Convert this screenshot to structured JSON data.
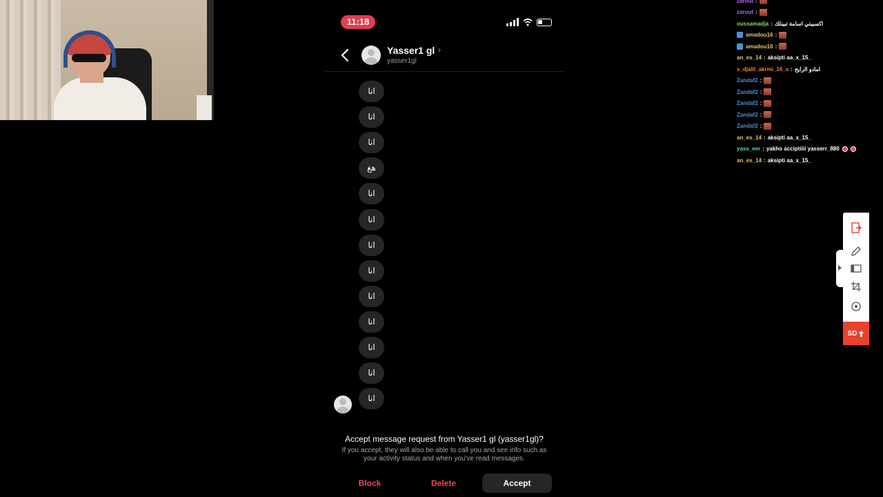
{
  "phone": {
    "status": {
      "time": "11:18"
    },
    "header": {
      "name": "Yasser1 gl",
      "chevron": "›",
      "username": "yasser1gl"
    },
    "messages": [
      "انا",
      "انا",
      "انا",
      "هغ",
      "انا",
      "انا",
      "انا",
      "انا",
      "انا",
      "انا",
      "انا",
      "انا",
      "انا"
    ],
    "request": {
      "title": "Accept message request from Yasser1 gl (yasser1gl)?",
      "body": "If you accept, they will also be able to call you and see info such as your activity status and when you've read messages."
    },
    "actions": {
      "block": "Block",
      "delete": "Delete",
      "accept": "Accept"
    },
    "colors": {
      "time_pill": "#e23d50",
      "destructive": "#ed4956",
      "bubble": "#262626"
    }
  },
  "chat": {
    "lines": [
      {
        "user": "zarout",
        "color": "#b06de8",
        "msg": "",
        "emote": true
      },
      {
        "user": "zarout",
        "color": "#b06de8",
        "msg": "",
        "emote": true
      },
      {
        "user": "oussamadja",
        "color": "#7ddc5b",
        "msg": "اكسيبتي اسامة تبينلك",
        "emote": false
      },
      {
        "user": "amadou16",
        "color": "#e9c46a",
        "msg": "",
        "emote": true,
        "badge": true
      },
      {
        "user": "amadou16",
        "color": "#e9c46a",
        "msg": "",
        "emote": true,
        "badge": true
      },
      {
        "user": "an_es_14",
        "color": "#e9c46a",
        "msg": "aksipti aa_x_15_",
        "emote": false
      },
      {
        "user": "x_djalil_akrmi_16_x",
        "color": "#e98a2c",
        "msg": "امادو الرايح",
        "emote": false
      },
      {
        "user": "Zandaf2",
        "color": "#4d8fdc",
        "msg": "",
        "emote": true
      },
      {
        "user": "Zandaf2",
        "color": "#4d8fdc",
        "msg": "",
        "emote": true
      },
      {
        "user": "Zandaf2",
        "color": "#4d8fdc",
        "msg": "",
        "emote": true
      },
      {
        "user": "Zandaf2",
        "color": "#4d8fdc",
        "msg": "",
        "emote": true
      },
      {
        "user": "Zandaf2",
        "color": "#4d8fdc",
        "msg": "",
        "emote": true
      },
      {
        "user": "an_es_14",
        "color": "#e9c46a",
        "msg": "aksipti aa_x_15_",
        "emote": false
      },
      {
        "user": "yass_eer",
        "color": "#5fd3a1",
        "msg": "yakho acciptiiii yasserr_880",
        "emote": false,
        "dots": true
      },
      {
        "user": "an_es_14",
        "color": "#e9c46a",
        "msg": "aksipti aa_x_15_",
        "emote": false
      }
    ]
  },
  "tools": {
    "items": [
      "exit-icon",
      "pen-icon",
      "window-icon",
      "crop-icon",
      "record-icon"
    ],
    "sd_label": "SD"
  }
}
